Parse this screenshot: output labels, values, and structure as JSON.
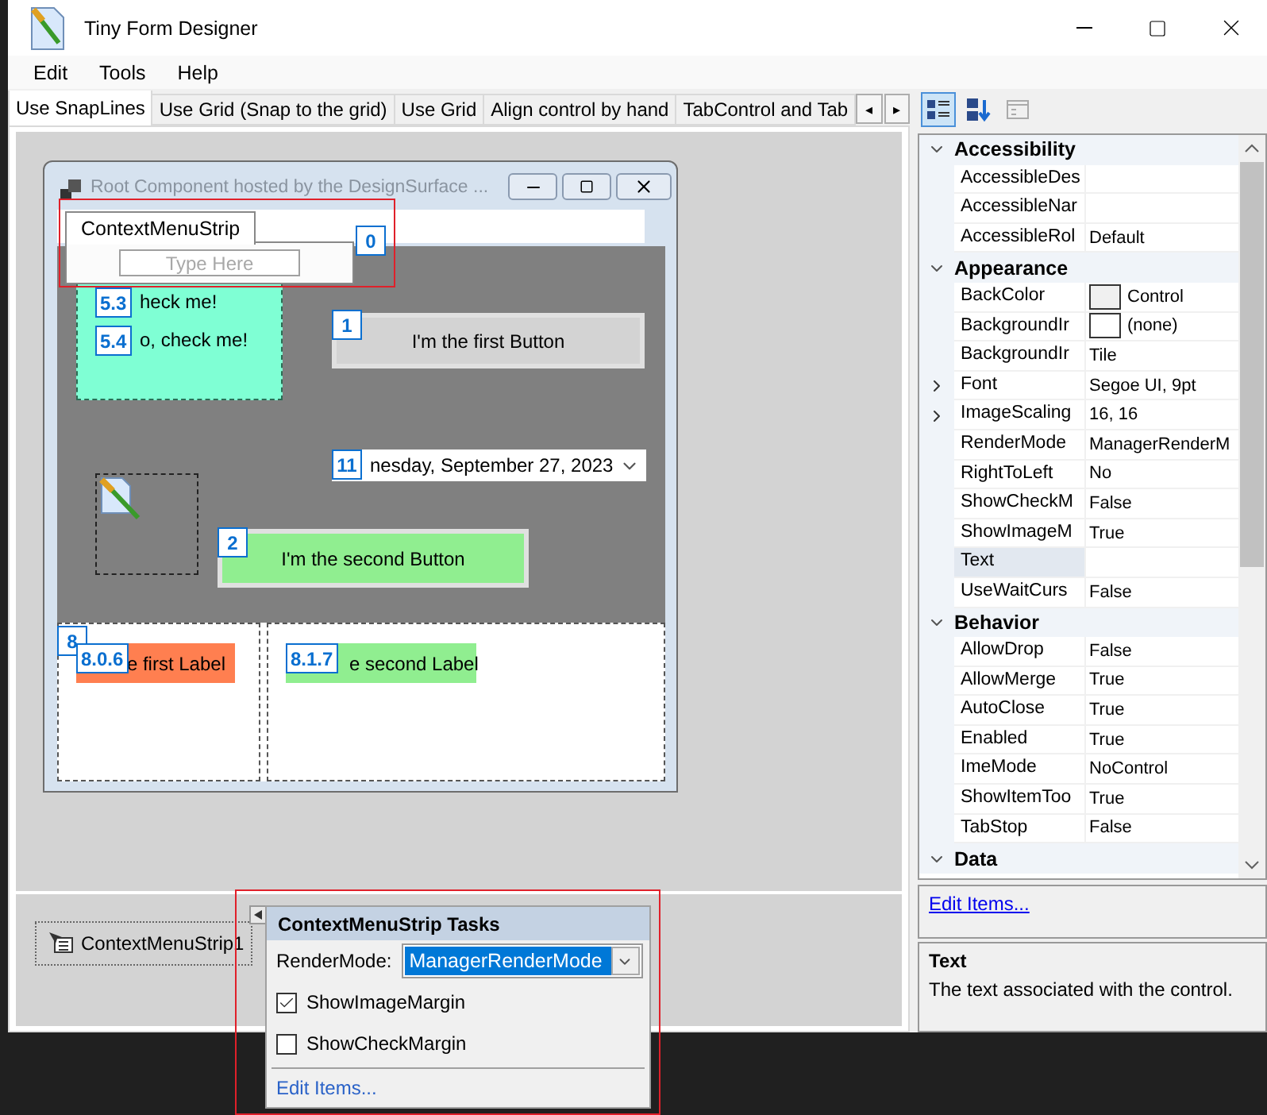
{
  "window": {
    "title": "Tiny Form Designer"
  },
  "menu": [
    "Edit",
    "Tools",
    "Help"
  ],
  "tabs": [
    {
      "label": "Use SnapLines",
      "selected": true
    },
    {
      "label": "Use Grid (Snap to the grid)",
      "selected": false
    },
    {
      "label": "Use Grid",
      "selected": false
    },
    {
      "label": "Align control by hand",
      "selected": false
    },
    {
      "label": "TabControl and Tab",
      "selected": false
    }
  ],
  "tab_scroll": [
    "◂",
    "▸"
  ],
  "designer": {
    "form_title": "Root Component hosted by the DesignSurface ...",
    "context_menu": {
      "label": "ContextMenuStrip",
      "placeholder": "Type Here"
    },
    "checkboxes": [
      "heck me!",
      "o, check me!"
    ],
    "buttons": [
      "I'm the first Button",
      "I'm the second Button"
    ],
    "date_picker": "nesday, September 27, 2023",
    "labels": [
      "e first Label",
      "e second Label"
    ],
    "tab_badges": [
      "0",
      "5.3",
      "5.4",
      "1",
      "11",
      "2",
      "8",
      "8.0.6",
      "8.1.7"
    ]
  },
  "tray": {
    "component": "ContextMenuStrip1"
  },
  "tasks": {
    "title": "ContextMenuStrip Tasks",
    "render_mode_label": "RenderMode:",
    "render_mode": "ManagerRenderMode",
    "options": [
      {
        "label": "ShowImageMargin",
        "checked": true
      },
      {
        "label": "ShowCheckMargin",
        "checked": false
      }
    ],
    "link": "Edit Items..."
  },
  "properties": {
    "toolbar": [
      {
        "kind": "categorized",
        "selected": true
      },
      {
        "kind": "alphabetical",
        "selected": false
      },
      {
        "kind": "pages",
        "selected": false
      }
    ],
    "categories": [
      {
        "name": "Accessibility",
        "expanded": true,
        "rows": [
          {
            "kind": "text",
            "name": "AccessibleDes",
            "selected": false
          },
          {
            "kind": "text",
            "name": "AccessibleNar",
            "selected": false
          },
          {
            "kind": "text",
            "name": "AccessibleRol",
            "value": "Default",
            "selected": false
          }
        ]
      },
      {
        "name": "Appearance",
        "expanded": true,
        "rows": [
          {
            "kind": "color",
            "name": "BackColor",
            "value": "Control",
            "color": "#f0f0f0",
            "selected": false
          },
          {
            "kind": "color",
            "name": "BackgroundIr",
            "value": "(none)",
            "color": "#ffffff",
            "selected": false
          },
          {
            "kind": "text",
            "name": "BackgroundIr",
            "value": "Tile",
            "selected": false
          },
          {
            "kind": "expandable",
            "name": "Font",
            "value": "Segoe UI, 9pt",
            "selected": false
          },
          {
            "kind": "expandable",
            "name": "ImageScaling",
            "value": "16, 16",
            "selected": false
          },
          {
            "kind": "text",
            "name": "RenderMode",
            "value": "ManagerRenderM",
            "selected": false
          },
          {
            "kind": "text",
            "name": "RightToLeft",
            "value": "No",
            "selected": false
          },
          {
            "kind": "text",
            "name": "ShowCheckM",
            "value": "False",
            "selected": false
          },
          {
            "kind": "text",
            "name": "ShowImageM",
            "value": "True",
            "selected": false
          },
          {
            "kind": "text",
            "name": "Text",
            "selected": true
          },
          {
            "kind": "text",
            "name": "UseWaitCurs",
            "value": "False",
            "selected": false
          }
        ]
      },
      {
        "name": "Behavior",
        "expanded": true,
        "rows": [
          {
            "kind": "text",
            "name": "AllowDrop",
            "value": "False",
            "selected": false
          },
          {
            "kind": "text",
            "name": "AllowMerge",
            "value": "True",
            "selected": false
          },
          {
            "kind": "text",
            "name": "AutoClose",
            "value": "True",
            "selected": false
          },
          {
            "kind": "text",
            "name": "Enabled",
            "value": "True",
            "selected": false
          },
          {
            "kind": "text",
            "name": "ImeMode",
            "value": "NoControl",
            "selected": false
          },
          {
            "kind": "text",
            "name": "ShowItemToo",
            "value": "True",
            "selected": false
          },
          {
            "kind": "text",
            "name": "TabStop",
            "value": "False",
            "selected": false
          }
        ]
      },
      {
        "name": "Data",
        "expanded": true
      }
    ],
    "command": "Edit Items...",
    "description_title": "Text",
    "description": "The text associated with the control."
  }
}
